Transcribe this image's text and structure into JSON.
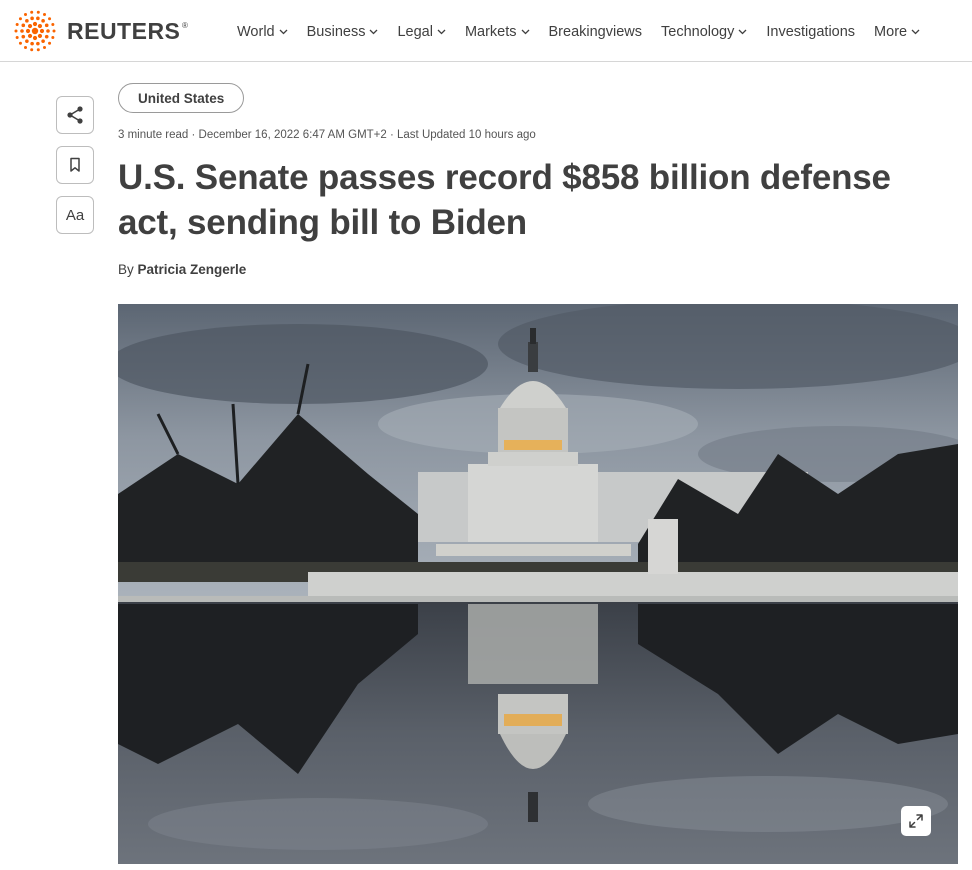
{
  "brand": {
    "name": "REUTERS",
    "registered": "®"
  },
  "nav": {
    "items": [
      {
        "label": "World",
        "dropdown": true
      },
      {
        "label": "Business",
        "dropdown": true
      },
      {
        "label": "Legal",
        "dropdown": true
      },
      {
        "label": "Markets",
        "dropdown": true
      },
      {
        "label": "Breakingviews",
        "dropdown": false
      },
      {
        "label": "Technology",
        "dropdown": true
      },
      {
        "label": "Investigations",
        "dropdown": false
      },
      {
        "label": "More",
        "dropdown": true
      }
    ]
  },
  "tools": {
    "text_size_label": "Aa"
  },
  "article": {
    "section_tag": "United States",
    "meta": "3 minute read · December 16, 2022 6:47 AM GMT+2 · Last Updated 10 hours ago",
    "headline": "U.S. Senate passes record $858 billion defense act, sending bill to Biden",
    "byline_prefix": "By ",
    "author": "Patricia Zengerle"
  },
  "icons": {
    "share": "share-icon",
    "bookmark": "bookmark-icon",
    "expand": "expand-icon",
    "chevron": "chevron-down-icon"
  },
  "colors": {
    "brand_orange": "#fa6400",
    "text": "#404040",
    "border": "#d6d6d6"
  }
}
